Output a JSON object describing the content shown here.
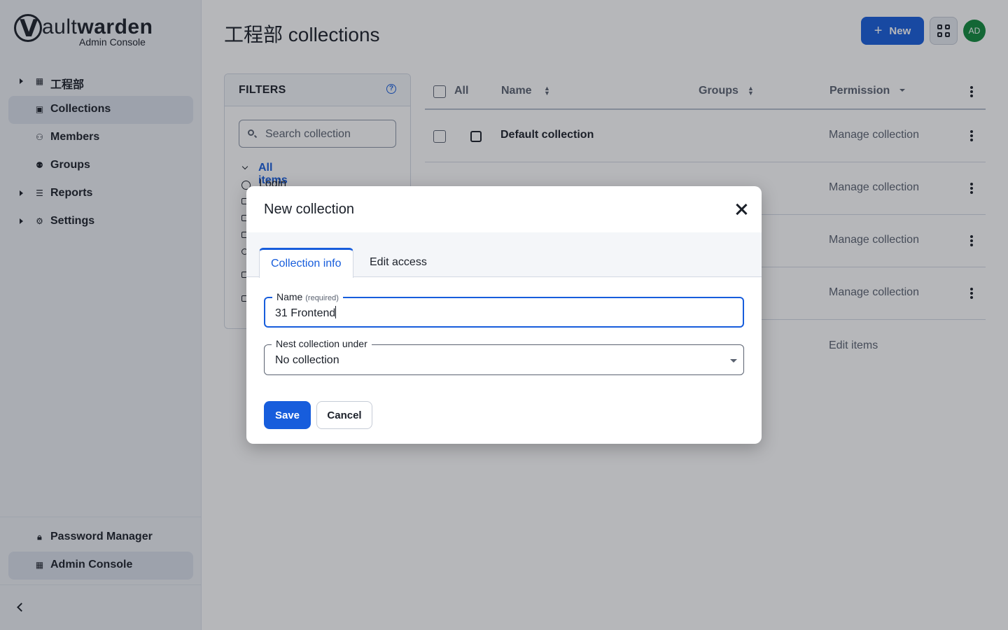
{
  "brand": {
    "wordmark_bold": "ault",
    "wordmark_rest": "warden",
    "subtitle": "Admin Console"
  },
  "sidebar": {
    "items": [
      {
        "label": "工程部",
        "icon": "organization-icon",
        "expandable": true,
        "active": false
      },
      {
        "label": "Collections",
        "icon": "collection-icon",
        "expandable": false,
        "active": true
      },
      {
        "label": "Members",
        "icon": "user-icon",
        "expandable": false,
        "active": false
      },
      {
        "label": "Groups",
        "icon": "users-icon",
        "expandable": false,
        "active": false
      },
      {
        "label": "Reports",
        "icon": "sliders-icon",
        "expandable": true,
        "active": false
      },
      {
        "label": "Settings",
        "icon": "gear-icon",
        "expandable": true,
        "active": false
      }
    ],
    "bottom": [
      {
        "label": "Password Manager",
        "icon": "lock-icon",
        "active": false
      },
      {
        "label": "Admin Console",
        "icon": "organization-icon",
        "active": true
      }
    ]
  },
  "page": {
    "title": "工程部 collections"
  },
  "header": {
    "new_label": "New",
    "avatar_initials": "AD"
  },
  "filters": {
    "title": "FILTERS",
    "search_placeholder": "Search collection",
    "tree": [
      {
        "label": "All items"
      },
      {
        "label": "Login"
      }
    ]
  },
  "table": {
    "columns": {
      "all": "All",
      "name": "Name",
      "groups": "Groups",
      "permission": "Permission"
    },
    "rows": [
      {
        "name": "Default collection",
        "permission": "Manage collection"
      },
      {
        "name": "",
        "permission": "Manage collection"
      },
      {
        "name": "",
        "permission": "Manage collection"
      },
      {
        "name": "",
        "permission": "Manage collection"
      }
    ],
    "last_permission": "Edit items"
  },
  "dialog": {
    "title": "New collection",
    "tabs": [
      {
        "label": "Collection info",
        "active": true
      },
      {
        "label": "Edit access",
        "active": false
      }
    ],
    "name_label": "Name",
    "name_required": "(required)",
    "name_value": "31 Frontend",
    "nest_label": "Nest collection under",
    "nest_value": "No collection",
    "save_label": "Save",
    "cancel_label": "Cancel"
  },
  "colors": {
    "accent": "#175ddc",
    "avatar": "#0f8a3c",
    "sidebar_bg": "#edf0f5",
    "active_bg": "#dae0ea"
  }
}
